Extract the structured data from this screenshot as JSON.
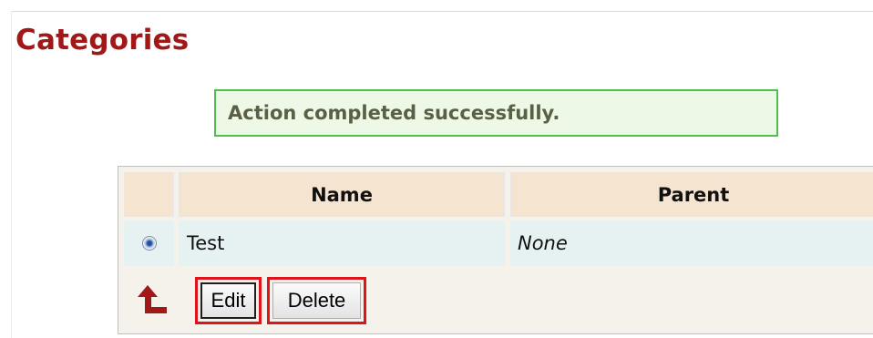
{
  "page": {
    "title": "Categories"
  },
  "message": {
    "text": "Action completed successfully.",
    "type": "success"
  },
  "grid": {
    "columns": [
      "Name",
      "Parent"
    ],
    "rows": [
      {
        "selected": true,
        "name": "Test",
        "parent": "None"
      }
    ]
  },
  "actions": {
    "edit_label": "Edit",
    "delete_label": "Delete",
    "up_icon": "arrow-up-left-icon"
  },
  "colors": {
    "title": "#a01818",
    "header_bg": "#f5e4d0",
    "row_bg": "#e6f1f1",
    "success_border": "#4fbf4f",
    "success_bg": "#eef8e6",
    "highlight": "#e0131b"
  }
}
